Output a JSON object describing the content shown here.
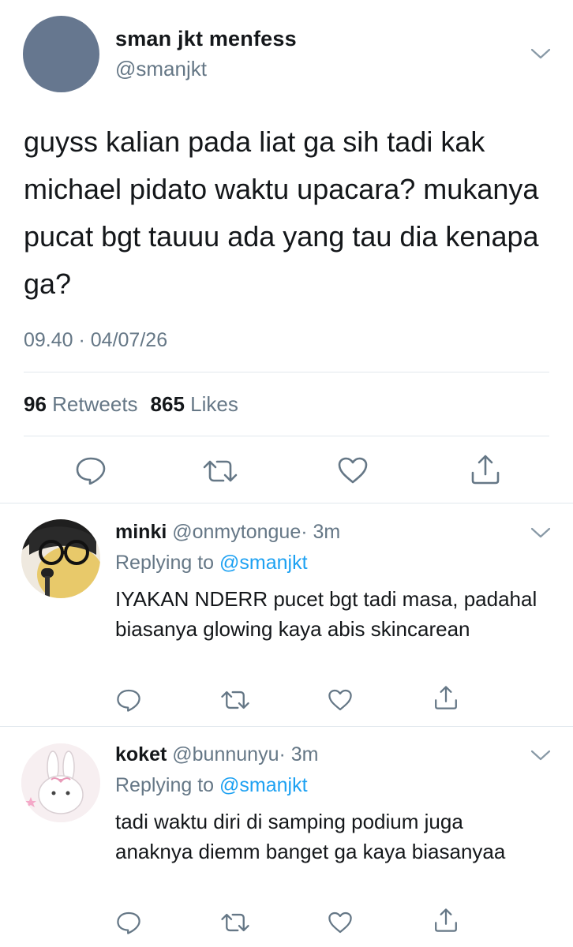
{
  "tweet": {
    "display_name": "sman jkt menfess",
    "handle": "@smanjkt",
    "text": "guyss kalian pada liat ga sih tadi kak michael pidato waktu upacara? mukanya pucat bgt tauuu ada yang tau dia kenapa ga?",
    "timestamp": "09.40 · 04/07/26",
    "retweets_count": "96",
    "retweets_label": "Retweets",
    "likes_count": "865",
    "likes_label": "Likes",
    "avatar_color": "#66778f"
  },
  "replies": [
    {
      "display_name": "minki",
      "handle": "@onmytongue",
      "time": "· 3m",
      "replying_label": "Replying to",
      "replying_handle": "@smanjkt",
      "text": "IYAKAN NDERR pucet bgt tadi masa, padahal biasanya glowing kaya abis skincarean"
    },
    {
      "display_name": "koket",
      "handle": "@bunnunyu",
      "time": "· 3m",
      "replying_label": "Replying to",
      "replying_handle": "@smanjkt",
      "text": "tadi waktu diri di samping podium juga anaknya diemm banget ga kaya biasanyaa"
    }
  ],
  "icons": {
    "reply": "reply-icon",
    "retweet": "retweet-icon",
    "like": "heart-icon",
    "share": "share-icon",
    "menu": "chevron-down-icon"
  },
  "colors": {
    "text": "#14171a",
    "secondary": "#657786",
    "link": "#1da1f2",
    "divider": "#e1e8ed"
  }
}
